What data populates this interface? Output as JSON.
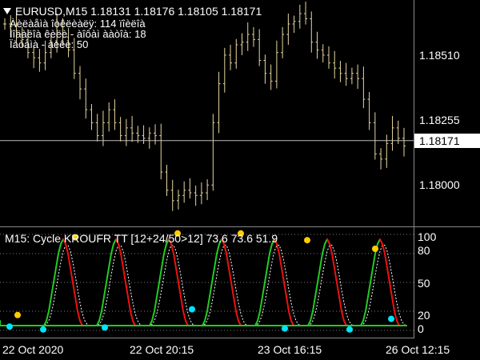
{
  "header": {
    "symbol_line": "EURUSD,M15  1.18131 1.18176 1.18105 1.18171",
    "info_line_1": "Àèëàåìà îòêëèàëÿ: 114 ïîèëîà",
    "info_line_2": "Ìîäàëîà êèëè - àîôàì ààòîà: 18",
    "info_line_3": "Ïàòàìà - àèêè: 50"
  },
  "indicator": {
    "title": "M15: Cycle KROUFR TT  [12+24/50>12] 73.6 73.6 51.9"
  },
  "price_axis": {
    "labels": [
      "1.18510",
      "1.18255",
      "1.18171",
      "1.18000"
    ],
    "current_price": "1.18171"
  },
  "indicator_axis": {
    "labels": [
      "100",
      "80",
      "50",
      "20",
      "0"
    ]
  },
  "time_axis": {
    "labels": [
      "22 Oct 2020",
      "22 Oct 20:15",
      "23 Oct 16:15",
      "26 Oct 12:15"
    ]
  },
  "colors": {
    "background": "#000000",
    "price_bars": "#e6d6a0",
    "rising": "#22cc22",
    "falling": "#ee1111",
    "signal_line": "#ffffff",
    "peak_dot": "#ffcc00",
    "trough_dot": "#00e5ff",
    "grid": "#777777"
  },
  "chart_data": [
    {
      "type": "bar",
      "ylim": [
        1.1785,
        1.187
      ],
      "reference_level": 1.18171,
      "close": [
        1.1862,
        1.1861,
        1.1858,
        1.1856,
        1.1851,
        1.1849,
        1.1847,
        1.1851,
        1.1855,
        1.1862,
        1.1857,
        1.1852,
        1.1843,
        1.1837,
        1.1829,
        1.1824,
        1.1819,
        1.1824,
        1.1829,
        1.1824,
        1.1819,
        1.1822,
        1.182,
        1.1819,
        1.1818,
        1.182,
        1.1819,
        1.1805,
        1.1798,
        1.1794,
        1.1796,
        1.1798,
        1.1797,
        1.1796,
        1.1797,
        1.18,
        1.1824,
        1.1839,
        1.185,
        1.1847,
        1.1854,
        1.1855,
        1.1858,
        1.1856,
        1.1848,
        1.1843,
        1.184,
        1.1851,
        1.1858,
        1.1862,
        1.1863,
        1.1866,
        1.1864,
        1.1855,
        1.1852,
        1.185,
        1.1847,
        1.1845,
        1.1843,
        1.1841,
        1.1843,
        1.1841,
        1.1833,
        1.1824,
        1.1812,
        1.181,
        1.1816,
        1.1822,
        1.1818,
        1.1815
      ]
    },
    {
      "type": "line",
      "ylim": [
        0,
        100
      ],
      "levels": [
        0,
        20,
        50,
        80,
        100
      ],
      "x": [
        0,
        4,
        8,
        12,
        15,
        18,
        21,
        24,
        27,
        30,
        33,
        36,
        39,
        42,
        45,
        48,
        51,
        54,
        57,
        60,
        63,
        66,
        69,
        72,
        75,
        78,
        81,
        84,
        87,
        90,
        93,
        96,
        99,
        102,
        105,
        108,
        111,
        114,
        117,
        120,
        123,
        126,
        129,
        132,
        135,
        138,
        141,
        144,
        147,
        150,
        153,
        156,
        159,
        162,
        165,
        168,
        171,
        174,
        177,
        180,
        183,
        186,
        189,
        192,
        195,
        198,
        201,
        204,
        207,
        210,
        213,
        216,
        219,
        222,
        225,
        228,
        231,
        234,
        237,
        240,
        243,
        246,
        249,
        252,
        255,
        258,
        261,
        264,
        267,
        270,
        273,
        276,
        279,
        282,
        285,
        288,
        291,
        294,
        297,
        300,
        303,
        306,
        309,
        312,
        315,
        318,
        321,
        324,
        327,
        330,
        333,
        336,
        339,
        342,
        345,
        348,
        351,
        354,
        357,
        360,
        363,
        366,
        369,
        372,
        375,
        378,
        381,
        384,
        387,
        390,
        393,
        396,
        399,
        402,
        405,
        408,
        411,
        414,
        417,
        420,
        423,
        426,
        429,
        432,
        435,
        438,
        441,
        444,
        447,
        450,
        453,
        456,
        459,
        462,
        465,
        468,
        471,
        474,
        477,
        480,
        483,
        486,
        489,
        492,
        495,
        498,
        501,
        504
      ],
      "series": [
        {
          "values": [
            5,
            5,
            5,
            5,
            5,
            5,
            5,
            5,
            5,
            5,
            5,
            5,
            5,
            5,
            5,
            5,
            5,
            10,
            20,
            35,
            50,
            65,
            80,
            90,
            95,
            90,
            80,
            65,
            50,
            35,
            20,
            10,
            5,
            5,
            5,
            5,
            5,
            5,
            5,
            10,
            20,
            35,
            50,
            65,
            80,
            90,
            95,
            90,
            80,
            65,
            50,
            35,
            20,
            10,
            5,
            5,
            5,
            5,
            5,
            5,
            5,
            10,
            20,
            35,
            50,
            65,
            80,
            90,
            95,
            90,
            80,
            65,
            50,
            35,
            20,
            10,
            5,
            5,
            5,
            5,
            5,
            5,
            5,
            10,
            20,
            35,
            50,
            65,
            80,
            90,
            95,
            90,
            80,
            65,
            50,
            35,
            20,
            10,
            5,
            5,
            5,
            5,
            5,
            5,
            5,
            10,
            20,
            35,
            50,
            65,
            80,
            90,
            95,
            90,
            80,
            65,
            50,
            35,
            20,
            10,
            5,
            5,
            5,
            5,
            5,
            5,
            5,
            10,
            20,
            35,
            50,
            65,
            80,
            90,
            95,
            90,
            80,
            65,
            50,
            35,
            20,
            10,
            5,
            5,
            5,
            5,
            5,
            5,
            5,
            10,
            20,
            35,
            50,
            65,
            80,
            90,
            95,
            90,
            80,
            65,
            50,
            35,
            20,
            10,
            5,
            5,
            5,
            5,
            5,
            5,
            5,
            10
          ]
        }
      ],
      "peaks": [
        [
          18,
          16
        ],
        [
          90,
          97
        ],
        [
          218,
          101
        ],
        [
          297,
          101
        ],
        [
          380,
          94
        ],
        [
          465,
          85
        ]
      ],
      "troughs": [
        [
          8,
          4
        ],
        [
          50,
          1
        ],
        [
          127,
          3
        ],
        [
          236,
          22
        ],
        [
          352,
          2
        ],
        [
          433,
          1
        ],
        [
          485,
          12
        ]
      ]
    }
  ]
}
